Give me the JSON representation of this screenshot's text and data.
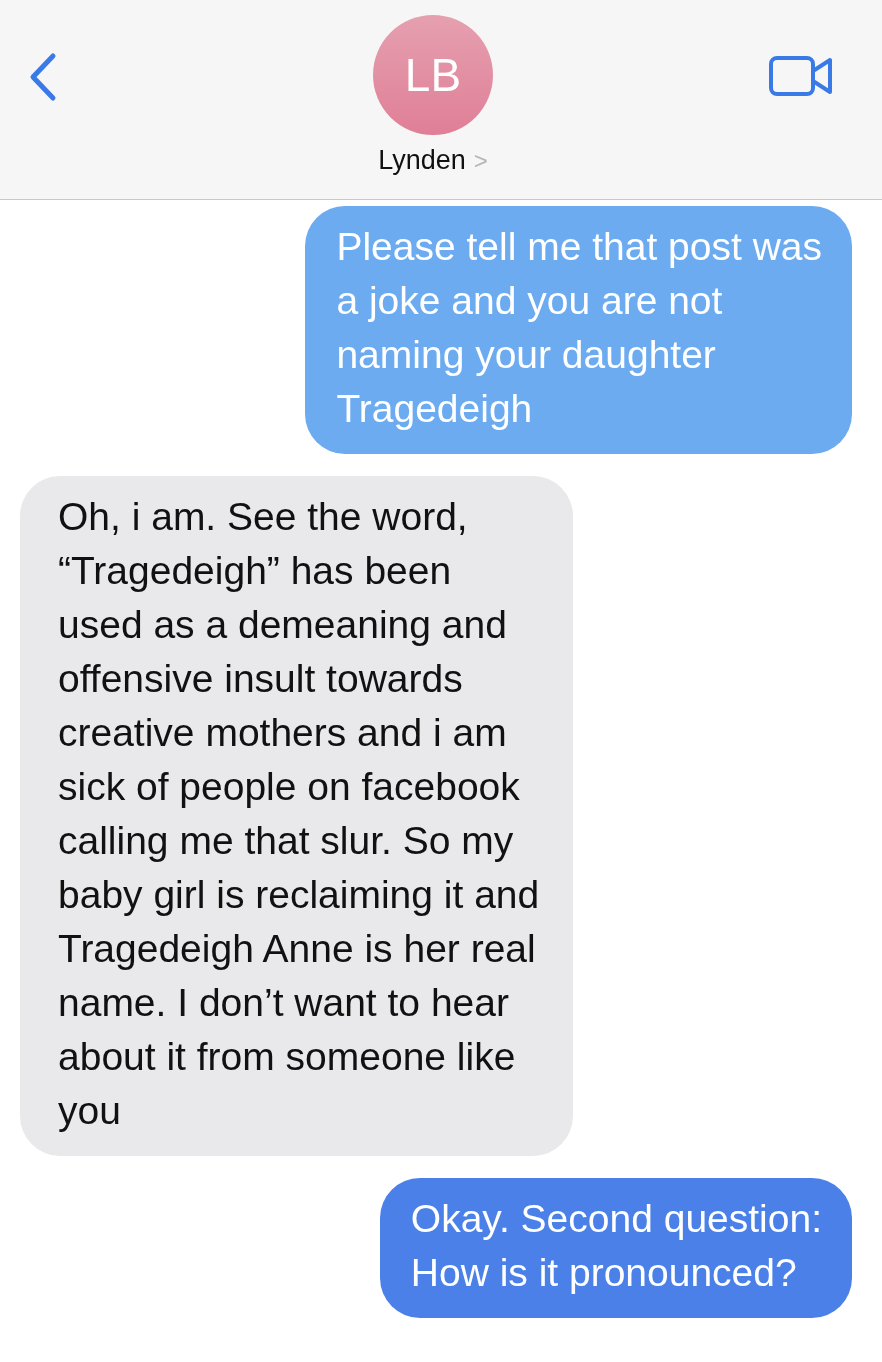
{
  "header": {
    "initials": "LB",
    "contact_name": "Lynden",
    "chevron": ">"
  },
  "messages": [
    {
      "kind": "sent",
      "color": "#6cabf0",
      "text": "Please tell me that post was\na joke and you are not\nnaming your daughter\nTragedeigh"
    },
    {
      "kind": "received",
      "color": "#e9e9eb",
      "text": "Oh, i am. See the word,\n“Tragedeigh” has been\nused as a demeaning and\noffensive insult towards\ncreative mothers and i am\nsick of people on facebook\ncalling me that slur. So my\nbaby girl is reclaiming it and\nTragedeigh Anne is her real\nname. I don’t want to hear\nabout it from someone like\nyou"
    },
    {
      "kind": "sent",
      "color": "#4a80e8",
      "text": "Okay. Second question:\nHow is it pronounced?"
    }
  ]
}
